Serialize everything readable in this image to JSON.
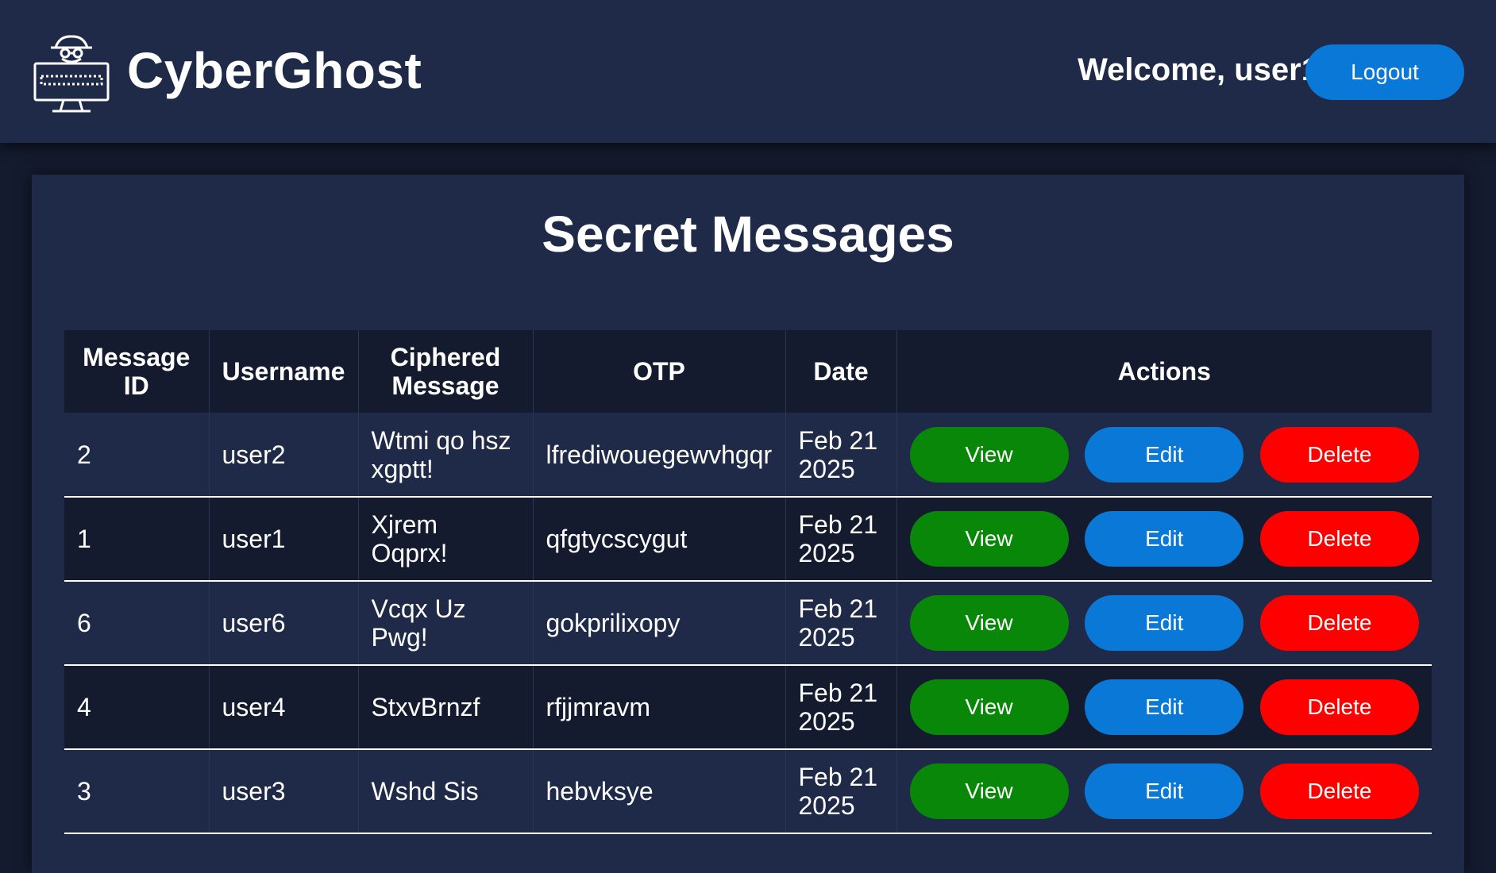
{
  "header": {
    "brand": "CyberGhost",
    "welcome": "Welcome, user1",
    "logout_label": "Logout",
    "logo_icon": "spy-hacker-icon"
  },
  "main": {
    "title": "Secret Messages",
    "columns": [
      "Message ID",
      "Username",
      "Ciphered Message",
      "OTP",
      "Date",
      "Actions"
    ],
    "rows": [
      {
        "id": "2",
        "username": "user2",
        "cipher": "Wtmi qo hsz xgptt!",
        "otp": "lfrediwouegewvhgqr",
        "date": "Feb 21 2025"
      },
      {
        "id": "1",
        "username": "user1",
        "cipher": "Xjrem Oqprx!",
        "otp": "qfgtycscygut",
        "date": "Feb 21 2025"
      },
      {
        "id": "6",
        "username": "user6",
        "cipher": "Vcqx Uz Pwg!",
        "otp": "gokprilixopy",
        "date": "Feb 21 2025"
      },
      {
        "id": "4",
        "username": "user4",
        "cipher": "StxvBrnzf",
        "otp": "rfjjmravm",
        "date": "Feb 21 2025"
      },
      {
        "id": "3",
        "username": "user3",
        "cipher": "Wshd Sis",
        "otp": "hebvksye",
        "date": "Feb 21 2025"
      }
    ],
    "actions": {
      "view": "View",
      "edit": "Edit",
      "delete": "Delete"
    }
  },
  "colors": {
    "header_bg": "#1f2a48",
    "page_bg": "#141b2e",
    "view": "#098709",
    "edit": "#0a78d6",
    "delete": "#ff0000"
  }
}
